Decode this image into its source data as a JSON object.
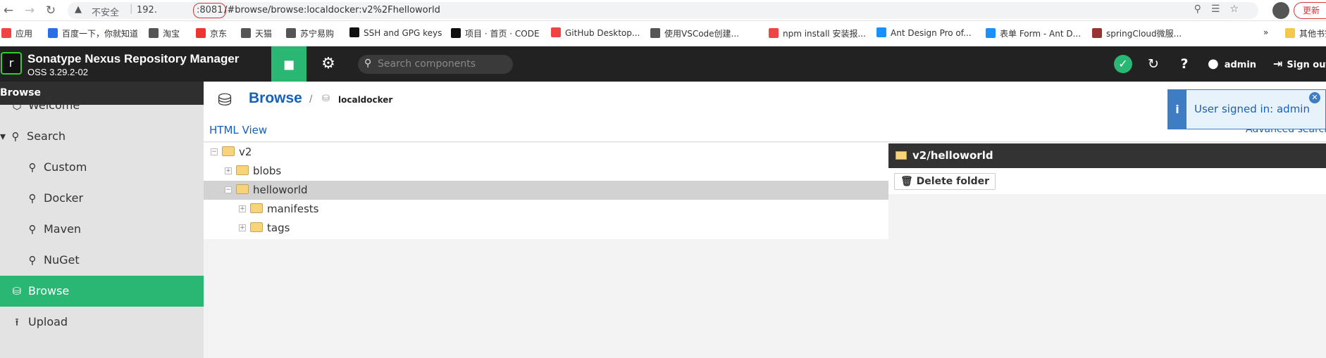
{
  "browser": {
    "back_icon": "back-arrow-icon",
    "forward_icon": "forward-arrow-icon",
    "reload_icon": "reload-icon",
    "insecure_label": "不安全",
    "url_host": "192.",
    "url_port": ":8081",
    "url_path": "/#browse/browse:localdocker:v2%2Fhelloworld",
    "update_label": "更新"
  },
  "bookmarks": [
    {
      "label": "应用",
      "color": "#e44"
    },
    {
      "label": "百度一下，你就知道",
      "color": "#2b6de5"
    },
    {
      "label": "淘宝",
      "color": "#555"
    },
    {
      "label": "京东",
      "color": "#e33"
    },
    {
      "label": "天猫",
      "color": "#555"
    },
    {
      "label": "苏宁易购",
      "color": "#555"
    },
    {
      "label": "SSH and GPG keys",
      "color": "#111"
    },
    {
      "label": "项目 · 首页 · CODE",
      "color": "#111"
    },
    {
      "label": "GitHub Desktop...",
      "color": "#e44"
    },
    {
      "label": "使用VSCode创建...",
      "color": "#555"
    },
    {
      "label": "npm install 安装报...",
      "color": "#e44"
    },
    {
      "label": "Ant Design Pro of...",
      "color": "#1890ff"
    },
    {
      "label": "表单 Form - Ant D...",
      "color": "#1890ff"
    },
    {
      "label": "springCloud微服...",
      "color": "#933"
    },
    {
      "label": "»",
      "color": "transparent"
    },
    {
      "label": "其他书签",
      "color": "#f2c94c"
    }
  ],
  "header": {
    "title": "Sonatype Nexus Repository Manager",
    "version": "OSS 3.29.2-02",
    "search_placeholder": "Search components",
    "user": "admin",
    "signout": "Sign out"
  },
  "sidebar": {
    "title": "Browse",
    "items": [
      {
        "label": "Welcome",
        "icon": "hexagon-icon"
      },
      {
        "label": "Search",
        "icon": "search-icon"
      },
      {
        "label": "Custom",
        "icon": "search-icon"
      },
      {
        "label": "Docker",
        "icon": "search-icon"
      },
      {
        "label": "Maven",
        "icon": "search-icon"
      },
      {
        "label": "NuGet",
        "icon": "search-icon"
      },
      {
        "label": "Browse",
        "icon": "database-icon"
      },
      {
        "label": "Upload",
        "icon": "upload-icon"
      }
    ]
  },
  "breadcrumb": {
    "root": "Browse",
    "repo": "localdocker"
  },
  "toolbar": {
    "html_view": "HTML View",
    "advanced_search": "Advanced search"
  },
  "tree": [
    {
      "label": "v2",
      "expander": "−"
    },
    {
      "label": "blobs",
      "expander": "+"
    },
    {
      "label": "helloworld",
      "expander": "−"
    },
    {
      "label": "manifests",
      "expander": "+"
    },
    {
      "label": "tags",
      "expander": "+"
    }
  ],
  "detail": {
    "title": "v2/helloworld",
    "delete_label": "Delete folder"
  },
  "toast": {
    "text": "User signed in: admin",
    "icon": "info-icon"
  }
}
